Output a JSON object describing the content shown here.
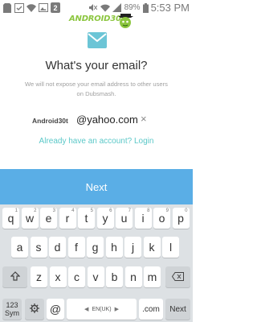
{
  "status_bar": {
    "battery_pct": "89%",
    "time": "5:53 PM",
    "notification_count": "2",
    "icons": [
      "sd-card-icon",
      "check-icon",
      "wifi-settings-icon",
      "image-icon",
      "notification-2-icon",
      "mute-icon",
      "wifi-icon",
      "signal-icon",
      "battery-icon"
    ]
  },
  "watermark": {
    "brand": "ANDROID30T"
  },
  "header": {
    "icon": "mail-icon",
    "title": "What's your email?",
    "subtitle": "We will not expose your email address to other users on Dubsmash."
  },
  "email_field": {
    "username": "Android30t",
    "domain": "@yahoo.com",
    "clear_icon": "×"
  },
  "login_link": "Already have an account? Login",
  "next_button": "Next",
  "keyboard": {
    "row1": [
      {
        "k": "q",
        "s": "1"
      },
      {
        "k": "w",
        "s": "2"
      },
      {
        "k": "e",
        "s": "3"
      },
      {
        "k": "r",
        "s": "4"
      },
      {
        "k": "t",
        "s": "5"
      },
      {
        "k": "y",
        "s": "6"
      },
      {
        "k": "u",
        "s": "7"
      },
      {
        "k": "i",
        "s": "8"
      },
      {
        "k": "o",
        "s": "9"
      },
      {
        "k": "p",
        "s": "0"
      }
    ],
    "row2": [
      "a",
      "s",
      "d",
      "f",
      "g",
      "h",
      "j",
      "k",
      "l"
    ],
    "row3": [
      "z",
      "x",
      "c",
      "v",
      "b",
      "n",
      "m"
    ],
    "sym_top": "123",
    "sym_bottom": "Sym",
    "at": "@",
    "space_label": "EN(UK)",
    "dotcom": ".com",
    "next_key": "Next",
    "shift_icon": "shift-icon",
    "backspace_icon": "backspace-icon",
    "settings_icon": "settings-icon"
  },
  "colors": {
    "accent": "#5aaee6",
    "link": "#5bc8c8",
    "brand": "#8cc63f"
  }
}
